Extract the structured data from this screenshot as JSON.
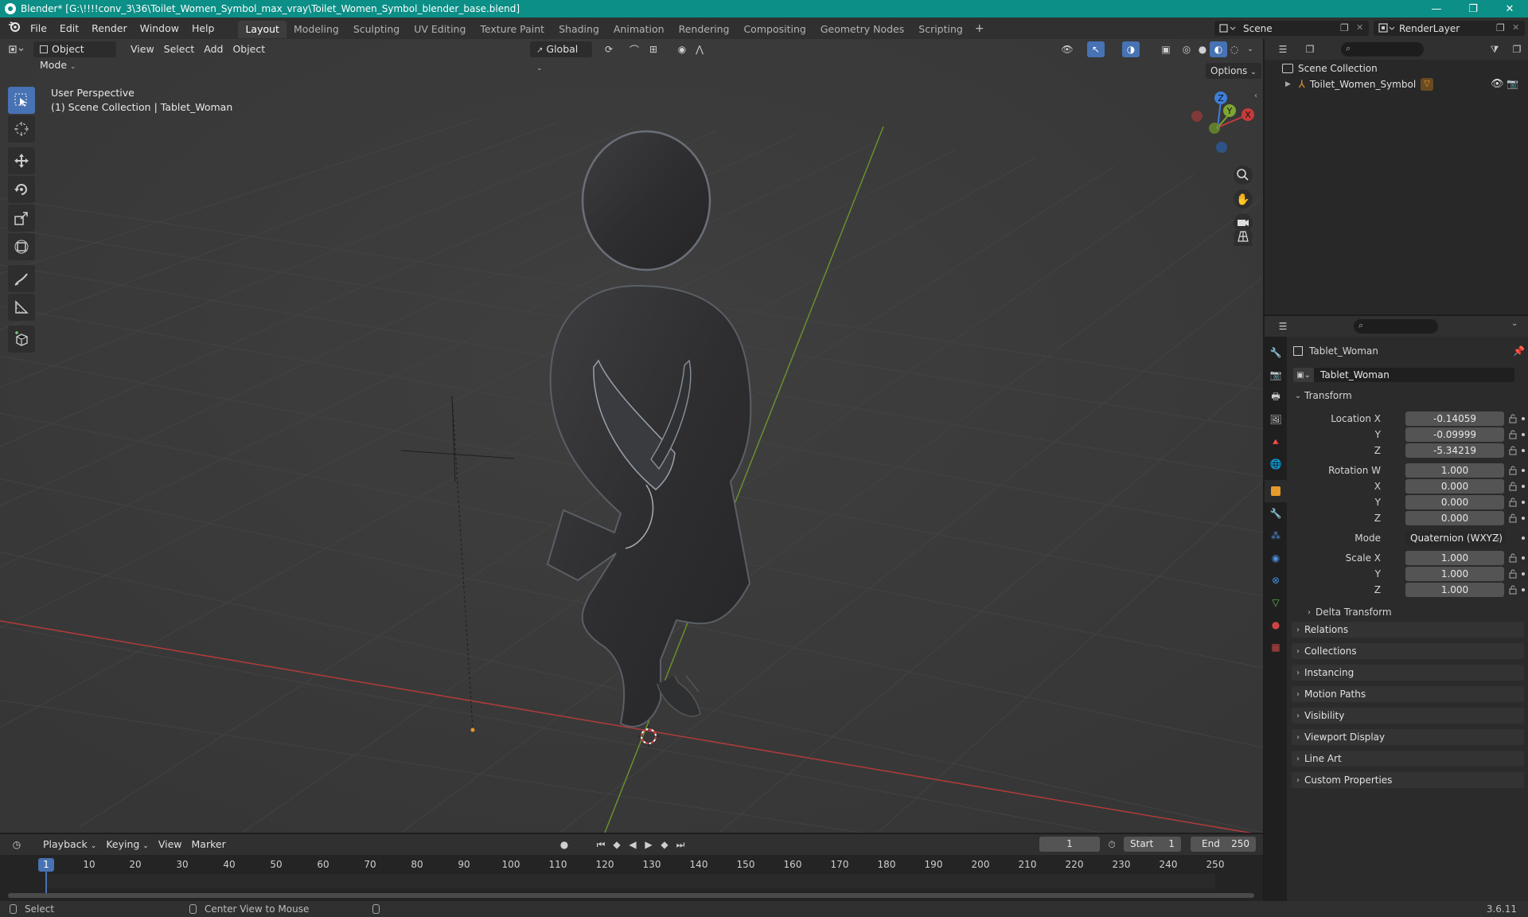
{
  "window": {
    "title": "Blender* [G:\\!!!!conv_3\\36\\Toilet_Women_Symbol_max_vray\\Toilet_Women_Symbol_blender_base.blend]",
    "minimize": "—",
    "maximize": "❐",
    "close": "✕"
  },
  "menubar": {
    "items": [
      "File",
      "Edit",
      "Render",
      "Window",
      "Help"
    ],
    "workspaces": [
      "Layout",
      "Modeling",
      "Sculpting",
      "UV Editing",
      "Texture Paint",
      "Shading",
      "Animation",
      "Rendering",
      "Compositing",
      "Geometry Nodes",
      "Scripting"
    ],
    "add": "+",
    "scene": "Scene",
    "render_layer": "RenderLayer"
  },
  "viewport": {
    "mode": "Object Mode",
    "menus": [
      "View",
      "Select",
      "Add",
      "Object"
    ],
    "orientation": "Global",
    "options": "Options",
    "info_line1": "User Perspective",
    "info_line2": "(1) Scene Collection | Tablet_Woman",
    "gizmo": {
      "z": "Z",
      "y": "Y",
      "x": "X"
    }
  },
  "outliner": {
    "root": "Scene Collection",
    "items": [
      "Toilet_Women_Symbol"
    ]
  },
  "properties": {
    "object_name": "Tablet_Woman",
    "data_name": "Tablet_Woman",
    "transform": {
      "title": "Transform",
      "location_label": "Location X",
      "location": [
        "-0.14059",
        "-0.09999",
        "-5.34219"
      ],
      "rotation_label": "Rotation W",
      "rotation": [
        "1.000",
        "0.000",
        "0.000",
        "0.000"
      ],
      "mode_label": "Mode",
      "mode": "Quaternion (WXYZ)",
      "scale_label": "Scale X",
      "scale": [
        "1.000",
        "1.000",
        "1.000"
      ],
      "y": "Y",
      "z": "Z",
      "x": "X"
    },
    "delta": "Delta Transform",
    "panels": [
      "Relations",
      "Collections",
      "Instancing",
      "Motion Paths",
      "Visibility",
      "Viewport Display",
      "Line Art",
      "Custom Properties"
    ]
  },
  "timeline": {
    "menus": [
      "Playback",
      "Keying",
      "View",
      "Marker"
    ],
    "current_frame": "1",
    "start_label": "Start",
    "start": "1",
    "end_label": "End",
    "end": "250",
    "ticks": [
      "1",
      "10",
      "20",
      "30",
      "40",
      "50",
      "60",
      "70",
      "80",
      "90",
      "100",
      "110",
      "120",
      "130",
      "140",
      "150",
      "160",
      "170",
      "180",
      "190",
      "200",
      "210",
      "220",
      "230",
      "240",
      "250"
    ]
  },
  "statusbar": {
    "select": "Select",
    "center": "Center View to Mouse",
    "version": "3.6.11"
  },
  "colors": {
    "titlebar": "#0b8f87",
    "accent": "#4772b3",
    "x_axis": "#c83a3a",
    "y_axis": "#7ea534",
    "z_axis": "#3d7fd9"
  }
}
